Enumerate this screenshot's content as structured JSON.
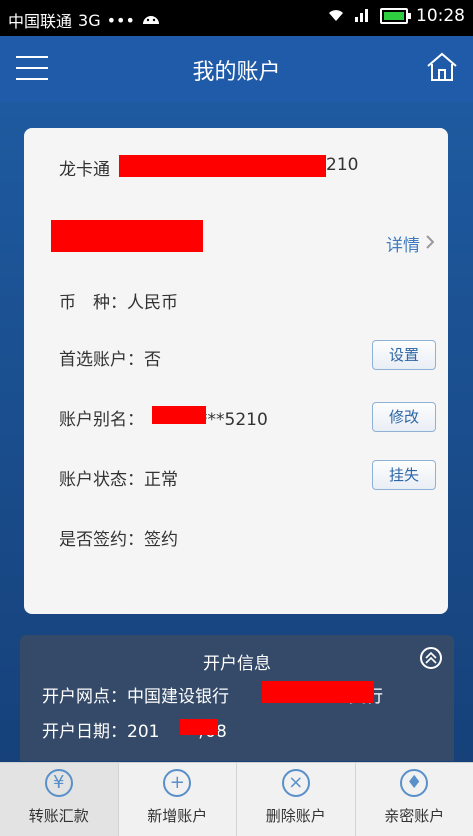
{
  "statusbar": {
    "carrier": "中国联通",
    "network": "3G",
    "dots": "•••",
    "time": "10:28"
  },
  "navbar": {
    "title": "我的账户",
    "menu_icon": "menu-icon",
    "home_icon": "home-icon"
  },
  "card": {
    "card_name": "龙卡通",
    "card_number_suffix": "210",
    "detail_label": "详情",
    "currency_label": "币　种：",
    "currency_value": "人民币",
    "preferred_label": "首选账户：",
    "preferred_value": "否",
    "preferred_button": "设置",
    "alias_label": "账户别名：",
    "alias_suffix": "***5210",
    "alias_button": "修改",
    "status_label": "账户状态：",
    "status_value": "正常",
    "status_button": "挂失",
    "signed_label": "是否签约：",
    "signed_value": "签约"
  },
  "open_info": {
    "header": "开户信息",
    "branch_label": "开户网点：",
    "branch_prefix": "中国建设银行",
    "branch_suffix": "支行",
    "date_label": "开户日期：",
    "date_prefix": "201",
    "date_suffix": "/08"
  },
  "tabs": [
    {
      "label": "转账汇款",
      "icon": "yuan-icon",
      "glyph": "¥"
    },
    {
      "label": "新增账户",
      "icon": "plus-icon",
      "glyph": "+"
    },
    {
      "label": "删除账户",
      "icon": "delete-icon",
      "glyph": "×"
    },
    {
      "label": "亲密账户",
      "icon": "flame-icon",
      "glyph": "♦"
    }
  ],
  "colors": {
    "nav_blue": "#1f5ba8",
    "accent": "#3f7bc0",
    "redaction": "#ff0000"
  }
}
